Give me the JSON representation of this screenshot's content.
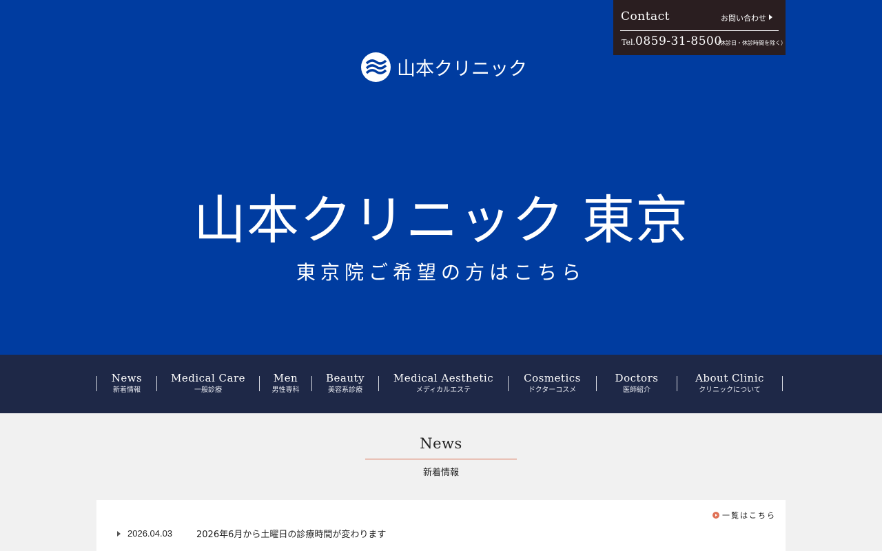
{
  "header": {
    "logo_text": "山本クリニック",
    "contact": {
      "title": "Contact",
      "inquiry_label": "お問い合わせ",
      "tel_label": "Tel.",
      "tel": "0859-31-8500",
      "hours_note": "（休診日・休診時間を除く）"
    }
  },
  "hero": {
    "title": "山本クリニック 東京",
    "subtitle": "東京院ご希望の方はこちら"
  },
  "nav": {
    "items": [
      {
        "en": "News",
        "jp": "新着情報"
      },
      {
        "en": "Medical Care",
        "jp": "一般診療"
      },
      {
        "en": "Men",
        "jp": "男性専科"
      },
      {
        "en": "Beauty",
        "jp": "美容系診療"
      },
      {
        "en": "Medical Aesthetic",
        "jp": "メディカルエステ"
      },
      {
        "en": "Cosmetics",
        "jp": "ドクターコスメ"
      },
      {
        "en": "Doctors",
        "jp": "医師紹介"
      },
      {
        "en": "About Clinic",
        "jp": "クリニックについて"
      }
    ]
  },
  "news": {
    "title": "News",
    "subtitle": "新着情報",
    "more_label": "一覧はこちら",
    "items": [
      {
        "date": "2026.04.03",
        "text": "2026年6月から土曜日の診療時間が変わります"
      }
    ]
  },
  "colors": {
    "hero_bg": "#003ca0",
    "nav_bg": "#1e2847",
    "contact_bg": "#2a1e20",
    "accent": "#d96b4a",
    "page_bg": "#f1f1f1"
  }
}
